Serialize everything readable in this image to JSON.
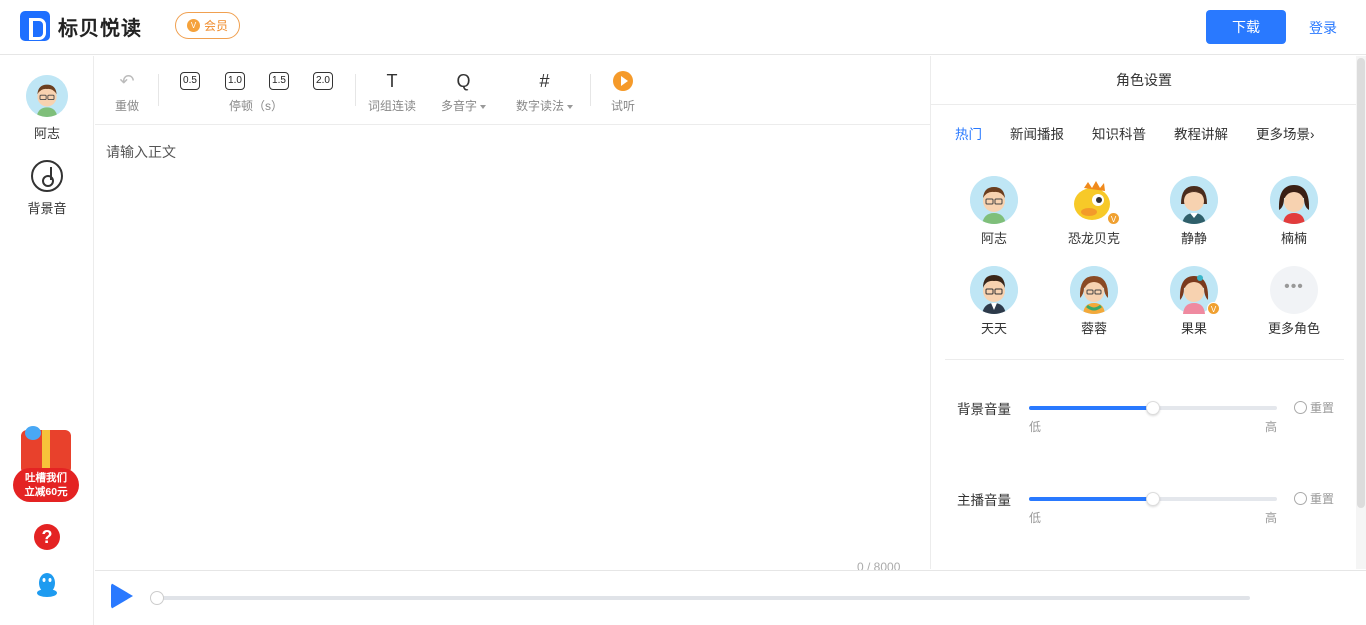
{
  "header": {
    "app_name": "标贝悦读",
    "vip_label": "会员",
    "download_label": "下载",
    "login_label": "登录"
  },
  "left_rail": {
    "items": [
      {
        "label": "阿志",
        "icon": "avatar"
      },
      {
        "label": "背景音",
        "icon": "music-disc-icon"
      }
    ],
    "promo": {
      "line1": "吐槽我们",
      "line2": "立减60元"
    },
    "help_icon": "question-icon",
    "qq_icon": "qq-penguin-icon"
  },
  "toolbar": {
    "undo_label": "重做",
    "pause_options": [
      "0.5",
      "1.0",
      "1.5",
      "2.0"
    ],
    "pause_label": "停顿（s）",
    "phrase_label": "词组连读",
    "polyphone_label": "多音字",
    "number_label": "数字读法",
    "preview_label": "试听"
  },
  "editor": {
    "placeholder": "请输入正文",
    "char_count": "0 / 8000"
  },
  "player": {
    "progress": 0
  },
  "role_panel": {
    "title": "角色设置",
    "categories": [
      {
        "label": "热门",
        "active": true
      },
      {
        "label": "新闻播报",
        "active": false
      },
      {
        "label": "知识科普",
        "active": false
      },
      {
        "label": "教程讲解",
        "active": false
      },
      {
        "label": "更多场景",
        "active": false
      }
    ],
    "roles": [
      {
        "name": "阿志",
        "vip": false
      },
      {
        "name": "恐龙贝克",
        "vip": true
      },
      {
        "name": "静静",
        "vip": false
      },
      {
        "name": "楠楠",
        "vip": false
      },
      {
        "name": "天天",
        "vip": false
      },
      {
        "name": "蓉蓉",
        "vip": false
      },
      {
        "name": "果果",
        "vip": true
      }
    ],
    "more_roles_label": "更多角色",
    "sliders": [
      {
        "label": "背景音量",
        "value": 0.5,
        "low": "低",
        "high": "高",
        "reset": "重置"
      },
      {
        "label": "主播音量",
        "value": 0.5,
        "low": "低",
        "high": "高",
        "reset": "重置"
      }
    ]
  },
  "colors": {
    "accent": "#2979ff",
    "vip": "#f08c2c",
    "promo_red": "#e42323"
  }
}
